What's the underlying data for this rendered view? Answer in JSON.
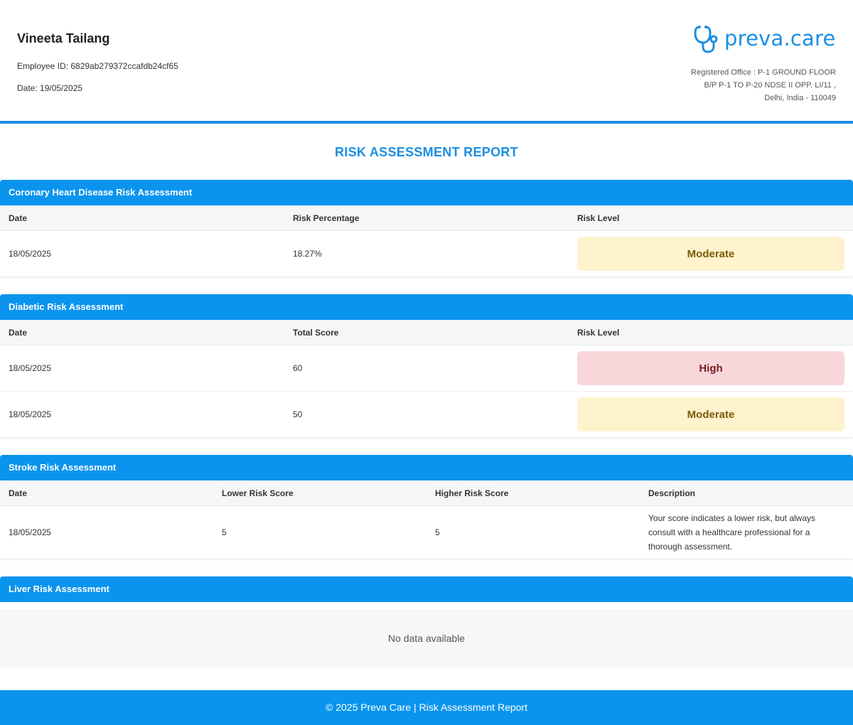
{
  "employee": {
    "name": "Vineeta Tailang",
    "id_line": "Employee ID: 6829ab279372ccafdb24cf65",
    "date_line": "Date: 19/05/2025"
  },
  "brand": {
    "name": "preva.care",
    "logo_icon": "stethoscope-icon",
    "accent_color": "#1a8fe3",
    "office_lines": [
      "Registered Office : P-1 GROUND FLOOR",
      "B/P P-1 TO P-20 NDSE II OPP. LI/11 ,",
      "Delhi, India - 110049"
    ]
  },
  "report_title": "RISK ASSESSMENT REPORT",
  "chd": {
    "title": "Coronary Heart Disease Risk Assessment",
    "headers": [
      "Date",
      "Risk Percentage",
      "Risk Level"
    ],
    "rows": [
      {
        "date": "18/05/2025",
        "value": "18.27%",
        "level": "Moderate"
      }
    ]
  },
  "diabetic": {
    "title": "Diabetic Risk Assessment",
    "headers": [
      "Date",
      "Total Score",
      "Risk Level"
    ],
    "rows": [
      {
        "date": "18/05/2025",
        "value": "60",
        "level": "High"
      },
      {
        "date": "18/05/2025",
        "value": "50",
        "level": "Moderate"
      }
    ]
  },
  "stroke": {
    "title": "Stroke Risk Assessment",
    "headers": [
      "Date",
      "Lower Risk Score",
      "Higher Risk Score",
      "Description"
    ],
    "rows": [
      {
        "date": "18/05/2025",
        "lower": "5",
        "higher": "5",
        "description": "Your score indicates a lower risk, but always consult with a healthcare professional for a thorough assessment."
      }
    ]
  },
  "liver": {
    "title": "Liver Risk Assessment",
    "empty_text": "No data available"
  },
  "footer": "© 2025 Preva Care | Risk Assessment Report",
  "colors": {
    "section_header": "#0a94ee",
    "moderate_bg": "#fff3cd",
    "moderate_text": "#7a5a06",
    "high_bg": "#f8d7da",
    "high_text": "#7d1c25"
  }
}
